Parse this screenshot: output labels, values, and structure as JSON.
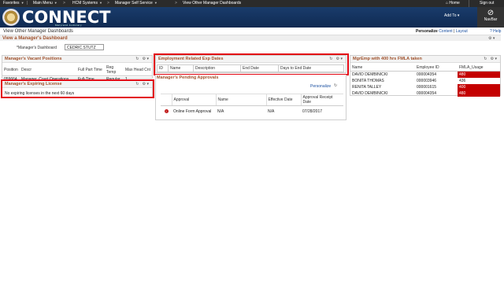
{
  "topbar": {
    "menus": [
      "Favorites",
      "Main Menu",
      "HCM Systems",
      "Manager Self Service",
      "View Other Manager Dashboards"
    ],
    "home": "Home",
    "signout": "Sign out"
  },
  "header": {
    "logo_text": "CONNECT",
    "logo_sub": "Maryland Judiciary",
    "add_to": "Add To",
    "navbar": "NavBar"
  },
  "page": {
    "breadcrumb": "View Other Manager Dashboards",
    "personalize": "Personalize",
    "content": "Content",
    "layout": "Layout",
    "help": "Help",
    "title": "View a Manager's Dashboard",
    "manager_label": "*Manager's Dashboard",
    "manager_value": "CEDRIC.STUTZ"
  },
  "vacant": {
    "title": "Manager's Vacant Positions",
    "columns": [
      "Position",
      "Descr",
      "Full Part Time",
      "Reg Temp",
      "Max Head Cnt"
    ],
    "rows": [
      [
        "059664",
        "Manager, Court Operations",
        "Full-Time",
        "Regular",
        "1"
      ]
    ]
  },
  "licenses": {
    "title": "Manager's Expiring License",
    "message": "No expiring licenses in the next 60 days"
  },
  "exp_dates": {
    "title": "Employment Related Exp Dates",
    "columns": [
      "ID",
      "Name",
      "Description",
      "End Date",
      "Days to End Date"
    ]
  },
  "approvals": {
    "title": "Manager's Pending Approvals",
    "personalize": "Personalize",
    "columns": [
      "Approval",
      "Name",
      "Effective Date",
      "Approval Receipt Date"
    ],
    "rows": [
      [
        "Online Form Approval",
        "N/A",
        "N/A",
        "07/28/2017"
      ]
    ]
  },
  "fmla": {
    "title": "MgrEmp with 400 hrs FMLA taken",
    "columns": [
      "Name",
      "Employee ID",
      "FMLA_Usage"
    ],
    "rows": [
      {
        "name": "DAVID DEMBINICKI",
        "id": "000004354",
        "usage": "480",
        "flag": true
      },
      {
        "name": "BONITA THOMAS",
        "id": "000003946",
        "usage": "436",
        "flag": false
      },
      {
        "name": "RENITA TALLEY",
        "id": "000001615",
        "usage": "400",
        "flag": true
      },
      {
        "name": "DAVID DEMBINICKI",
        "id": "000004354",
        "usage": "480",
        "flag": true
      }
    ]
  },
  "colors": {
    "header_bg": "#1a3c6b",
    "title_text": "#a0522d",
    "highlight_outline": "#e30613",
    "fmla_flag": "#c40000"
  },
  "icons": [
    "home-icon",
    "navbar-compass-icon",
    "refresh-icon",
    "gear-icon",
    "warning-icon",
    "help-icon"
  ]
}
